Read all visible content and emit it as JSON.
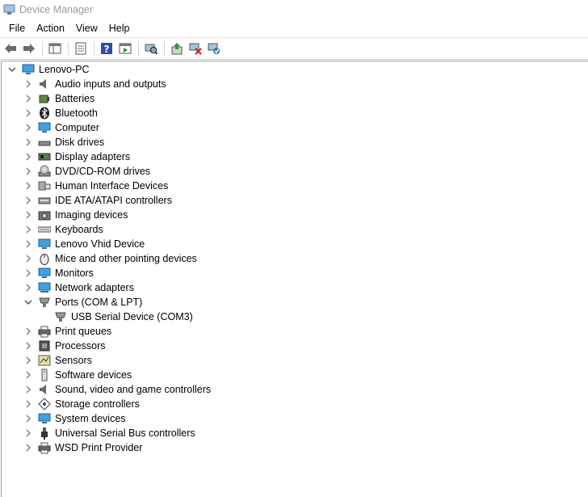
{
  "window": {
    "title": "Device Manager"
  },
  "menu": [
    "File",
    "Action",
    "View",
    "Help"
  ],
  "tree": {
    "root": "Lenovo-PC",
    "categories": [
      {
        "label": "Audio inputs and outputs",
        "icon": "speaker-icon"
      },
      {
        "label": "Batteries",
        "icon": "battery-icon"
      },
      {
        "label": "Bluetooth",
        "icon": "bluetooth-icon"
      },
      {
        "label": "Computer",
        "icon": "computer-icon"
      },
      {
        "label": "Disk drives",
        "icon": "disk-drive-icon"
      },
      {
        "label": "Display adapters",
        "icon": "display-adapter-icon"
      },
      {
        "label": "DVD/CD-ROM drives",
        "icon": "dvd-drive-icon"
      },
      {
        "label": "Human Interface Devices",
        "icon": "hid-icon"
      },
      {
        "label": "IDE ATA/ATAPI controllers",
        "icon": "ide-controller-icon"
      },
      {
        "label": "Imaging devices",
        "icon": "camera-icon"
      },
      {
        "label": "Keyboards",
        "icon": "keyboard-icon"
      },
      {
        "label": "Lenovo Vhid Device",
        "icon": "vhid-device-icon"
      },
      {
        "label": "Mice and other pointing devices",
        "icon": "mouse-icon"
      },
      {
        "label": "Monitors",
        "icon": "monitor-icon"
      },
      {
        "label": "Network adapters",
        "icon": "network-adapter-icon"
      },
      {
        "label": "Ports (COM & LPT)",
        "icon": "port-icon",
        "expanded": true,
        "children": [
          {
            "label": "USB Serial Device (COM3)",
            "icon": "port-icon"
          }
        ]
      },
      {
        "label": "Print queues",
        "icon": "printer-icon"
      },
      {
        "label": "Processors",
        "icon": "processor-icon"
      },
      {
        "label": "Sensors",
        "icon": "sensor-icon"
      },
      {
        "label": "Software devices",
        "icon": "software-device-icon"
      },
      {
        "label": "Sound, video and game controllers",
        "icon": "speaker-icon"
      },
      {
        "label": "Storage controllers",
        "icon": "storage-controller-icon"
      },
      {
        "label": "System devices",
        "icon": "system-device-icon"
      },
      {
        "label": "Universal Serial Bus controllers",
        "icon": "usb-icon"
      },
      {
        "label": "WSD Print Provider",
        "icon": "printer-icon"
      }
    ]
  }
}
